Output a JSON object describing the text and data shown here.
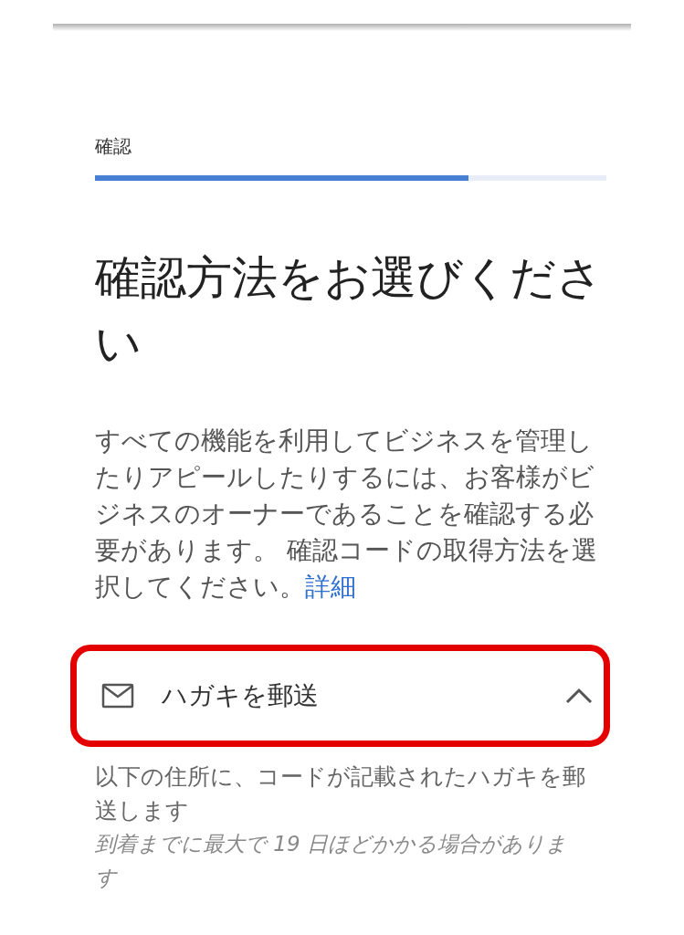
{
  "step": {
    "label": "確認",
    "level": 0.73
  },
  "heading": "確認方法をお選びください",
  "intro": {
    "text": "すべての機能を利用してビジネスを管理したりアピールしたりするには、お客様がビジネスのオーナーであることを確認する必要があります。 確認コードの取得方法を選択してください。",
    "link": "詳細"
  },
  "options": [
    {
      "label": "ハガキを郵送",
      "expanded": true,
      "highlighted": true,
      "description": "以下の住所に、コードが記載されたハガキを郵送します",
      "note": "到着までに最大で 19 日ほどかかる場合があります"
    }
  ]
}
